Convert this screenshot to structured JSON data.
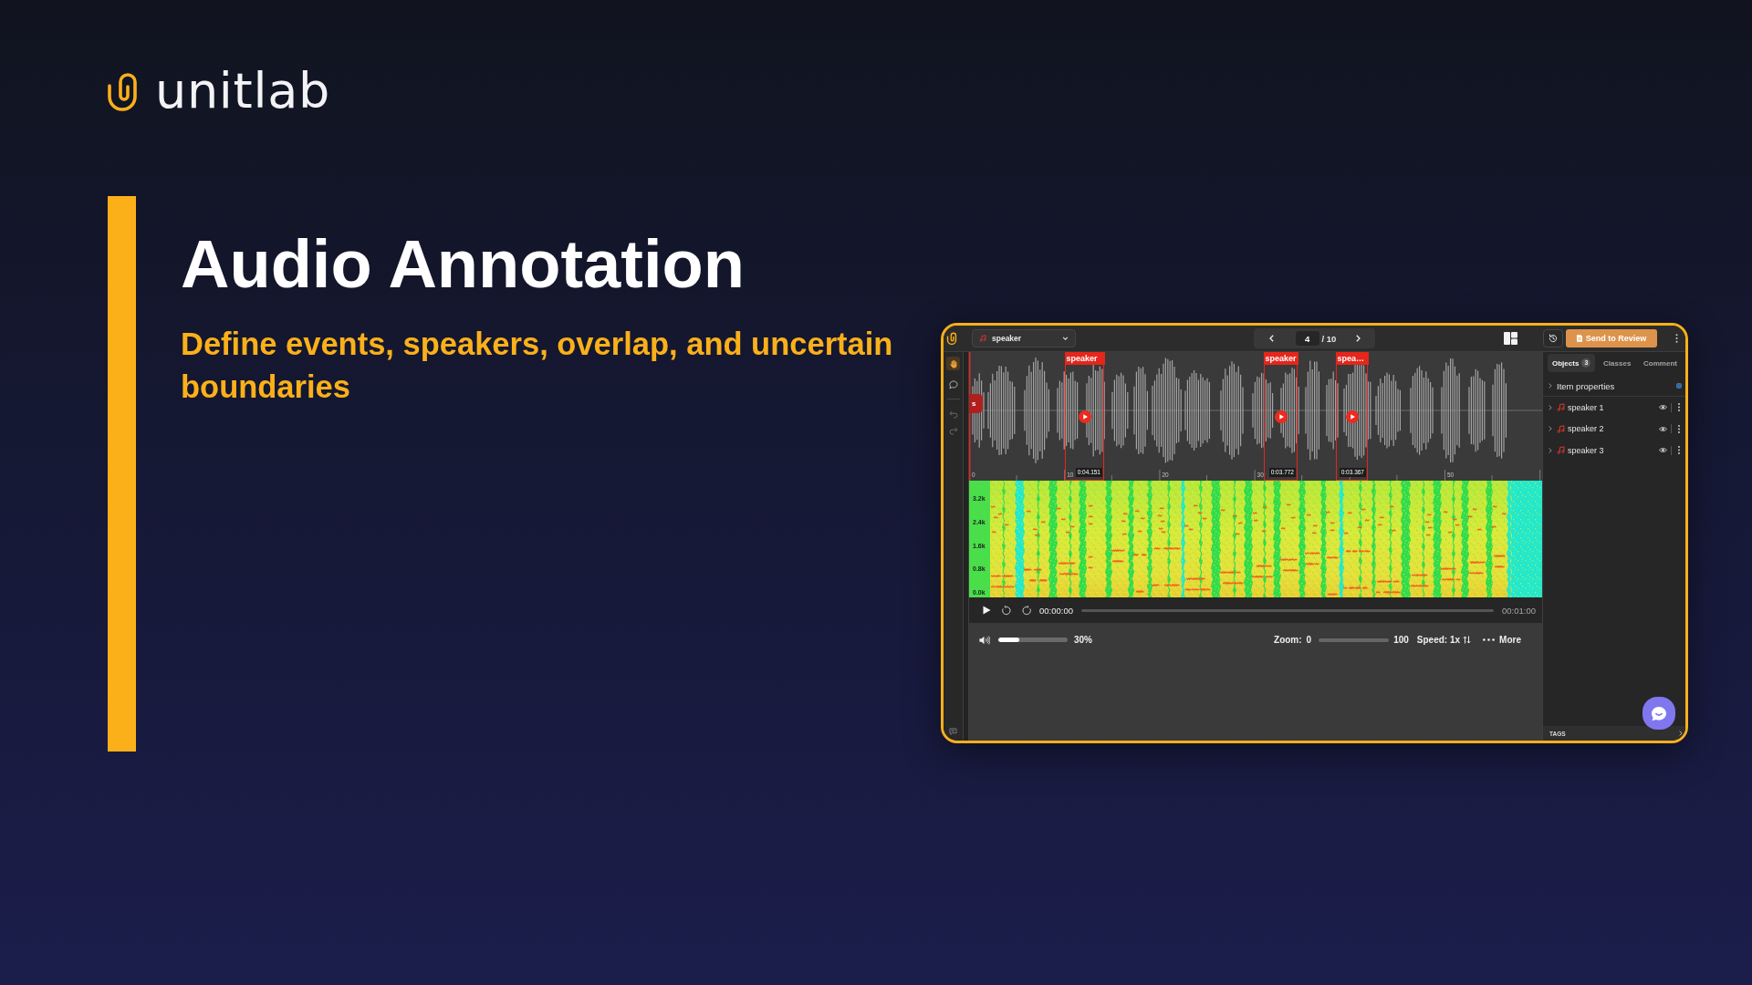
{
  "brand": {
    "name": "unitlab"
  },
  "hero": {
    "title": "Audio Annotation",
    "subtitle": "Define events, speakers, overlap, and uncertain boundaries"
  },
  "app": {
    "class_select": {
      "value": "speaker"
    },
    "pager": {
      "current": "4",
      "total": "/ 10"
    },
    "send_button": "Send to Review",
    "tools": [
      {
        "kind": "hand",
        "selected": true,
        "disabled": false
      },
      {
        "kind": "comment",
        "selected": false,
        "disabled": false
      },
      {
        "kind": "undo",
        "selected": false,
        "disabled": true
      },
      {
        "kind": "redo",
        "selected": false,
        "disabled": true
      }
    ],
    "waveform": {
      "partial_label": "s",
      "segments": [
        {
          "label": "speaker",
          "time": "0:04.151"
        },
        {
          "label": "speaker",
          "time": "0:03.772"
        },
        {
          "label": "spea…",
          "time": "0:03.367"
        }
      ],
      "ticks": [
        "0",
        "10",
        "20",
        "30",
        "50"
      ]
    },
    "spectrogram": {
      "freq_labels": [
        "3.2k",
        "2.4k",
        "1.6k",
        "0.8k",
        "0.0k"
      ]
    },
    "player": {
      "current_time": "00:00:00",
      "duration": "00:01:00"
    },
    "volume": {
      "level": 0.3,
      "reading": "30%"
    },
    "zoom": {
      "label": "Zoom:",
      "min": "0",
      "max": "100"
    },
    "speed": {
      "label": "Speed: 1x"
    },
    "more": {
      "label": "More"
    },
    "panel": {
      "tabs": [
        {
          "label": "Objects",
          "count": "3",
          "selected": true
        },
        {
          "label": "Classes",
          "selected": false
        },
        {
          "label": "Comment",
          "selected": false
        }
      ],
      "item_properties": {
        "label": "Item properties",
        "expanded": false
      },
      "objects": [
        {
          "name": "speaker 1",
          "expanded": false,
          "visible": true
        },
        {
          "name": "speaker 2",
          "expanded": false,
          "visible": true
        },
        {
          "name": "speaker 3",
          "expanded": false,
          "visible": true
        }
      ],
      "tags": {
        "label": "TAGS"
      }
    }
  }
}
